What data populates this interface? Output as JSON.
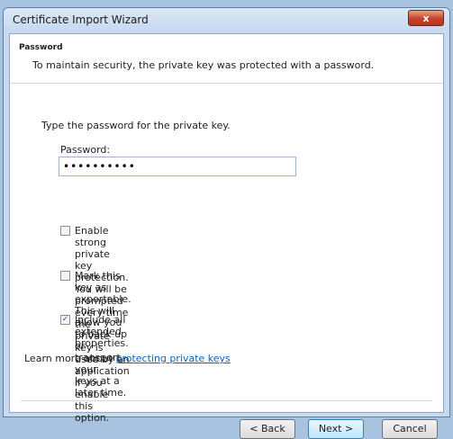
{
  "window": {
    "title": "Certificate Import Wizard",
    "close_glyph": "x"
  },
  "header": {
    "title": "Password",
    "description": "To maintain security, the private key was protected with a password."
  },
  "form": {
    "prompt": "Type the password for the private key.",
    "password_label": "Password:",
    "password_value": "••••••••••"
  },
  "options": [
    {
      "checked": false,
      "line1": "Enable strong private key protection. You will be prompted every time the",
      "line2": "private key is used by an application if you enable this option."
    },
    {
      "checked": false,
      "line1": "Mark this key as exportable. This will allow you to back up or transport your",
      "line2": "keys at a later time."
    },
    {
      "checked": true,
      "line1": "Include all extended properties.",
      "line2": ""
    }
  ],
  "learn_more": {
    "prefix": "Learn more about ",
    "link_text": "protecting private keys"
  },
  "buttons": {
    "back": "< Back",
    "next": "Next >",
    "cancel": "Cancel"
  },
  "colors": {
    "accent_link": "#0b63c5",
    "close_button": "#c7402a"
  }
}
